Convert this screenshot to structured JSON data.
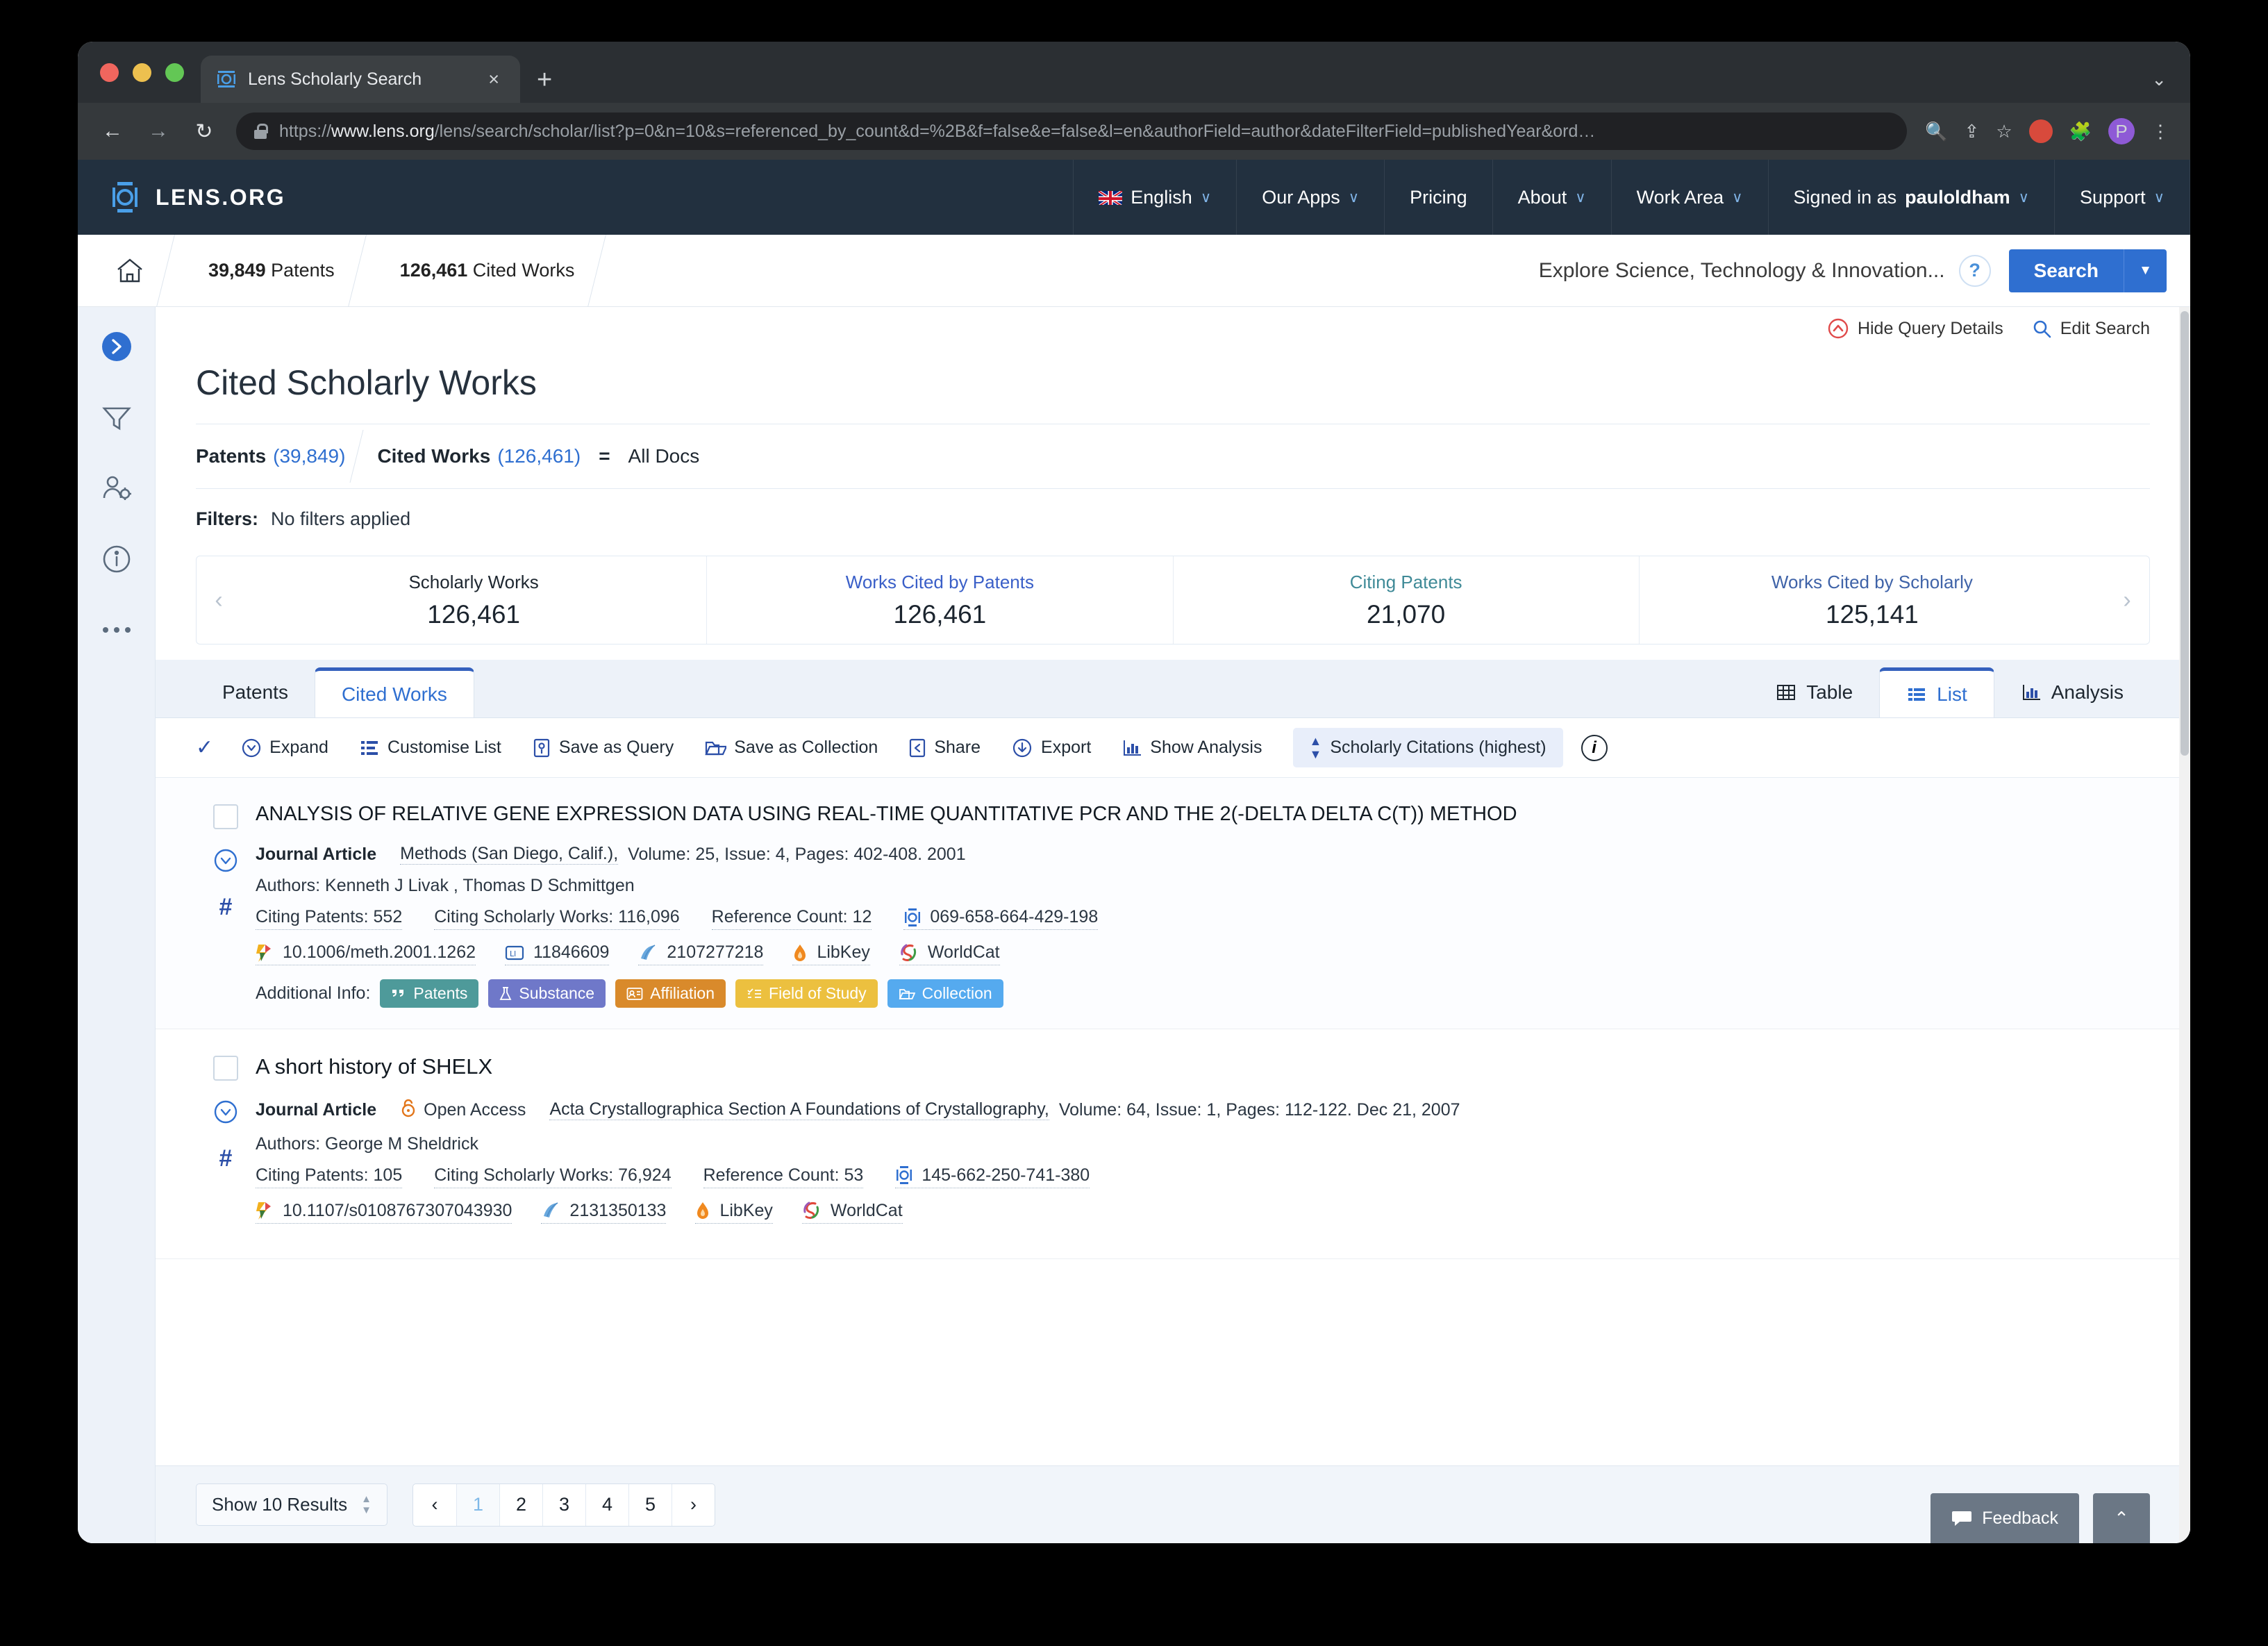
{
  "browser": {
    "tab": {
      "title": "Lens Scholarly Search",
      "favicon": "lens-logo-icon",
      "close": "×"
    },
    "newtab_label": "+",
    "nav": {
      "back": "←",
      "forward": "→",
      "reload": "↻"
    },
    "url": {
      "scheme": "https://",
      "host": "www.lens.org",
      "path": "/lens/search/scholar/list?p=0&n=10&s=referenced_by_count&d=%2B&f=false&e=false&l=en&authorField=author&dateFilterField=publishedYear&ord…"
    },
    "omni": {
      "zoom_icon": "search-zoom-icon",
      "share_icon": "share-icon",
      "star_icon": "bookmark-star-icon",
      "puzzle_icon": "extensions-puzzle-icon",
      "profile_initial": "P",
      "menu_icon": "⋮"
    }
  },
  "topnav": {
    "brand": "LENS.ORG",
    "items": [
      {
        "label": "English",
        "caret": "∨",
        "has_flag": true
      },
      {
        "label": "Our Apps",
        "caret": "∨"
      },
      {
        "label": "Pricing",
        "caret": ""
      },
      {
        "label": "About",
        "caret": "∨"
      },
      {
        "label": "Work Area",
        "caret": "∨"
      },
      {
        "label": "Signed in as ",
        "bold": "pauloldham",
        "caret": "∨"
      },
      {
        "label": "Support",
        "caret": "∨"
      }
    ]
  },
  "breadcrumb": {
    "home_icon": "home-icon",
    "items": [
      {
        "count": "39,849",
        "label": "Patents",
        "bold": false
      },
      {
        "count": "126,461",
        "label": "Cited Works",
        "bold": true
      }
    ],
    "explore_text": "Explore Science, Technology & Innovation...",
    "help": "?",
    "search_label": "Search",
    "search_caret": "▼"
  },
  "query": {
    "hide_details_label": "Hide Query Details",
    "edit_search_label": "Edit Search",
    "page_title": "Cited Scholarly Works",
    "seg1_label": "Patents",
    "seg1_count": "(39,849)",
    "seg2_label": "Cited Works",
    "seg2_count": "(126,461)",
    "equals": "=",
    "all_docs": "All Docs",
    "filters_label": "Filters:",
    "filters_value": "No filters applied"
  },
  "stats": {
    "prev": "‹",
    "next": "›",
    "cards": [
      {
        "label": "Scholarly Works",
        "value": "126,461",
        "style": "plain"
      },
      {
        "label": "Works Cited by Patents",
        "value": "126,461",
        "style": "link"
      },
      {
        "label": "Citing Patents",
        "value": "21,070",
        "style": "teal"
      },
      {
        "label": "Works Cited by Scholarly",
        "value": "125,141",
        "style": "slate"
      }
    ]
  },
  "viewtabs": {
    "left": [
      {
        "label": "Patents",
        "selected": false
      },
      {
        "label": "Cited Works",
        "selected": true
      }
    ],
    "right": [
      {
        "label": "Table",
        "icon": "table-grid-icon",
        "selected": false
      },
      {
        "label": "List",
        "icon": "list-icon",
        "selected": true
      },
      {
        "label": "Analysis",
        "icon": "bar-chart-icon",
        "selected": false
      }
    ]
  },
  "toolbar": {
    "select_all_icon": "checkmark-icon",
    "items": [
      {
        "label": "Expand",
        "icon": "chevron-down-circle-icon"
      },
      {
        "label": "Customise List",
        "icon": "customise-list-icon"
      },
      {
        "label": "Save as Query",
        "icon": "save-query-icon"
      },
      {
        "label": "Save as Collection",
        "icon": "folder-icon"
      },
      {
        "label": "Share",
        "icon": "share-icon"
      },
      {
        "label": "Export",
        "icon": "export-download-icon"
      },
      {
        "label": "Show Analysis",
        "icon": "bar-chart-icon"
      }
    ],
    "sort_label": "Scholarly Citations (highest)",
    "sort_icon": "sort-updown-icon",
    "info_icon": "info-circle-icon"
  },
  "results": [
    {
      "title": "ANALYSIS OF RELATIVE GENE EXPRESSION DATA USING REAL-TIME QUANTITATIVE PCR AND THE 2(-DELTA DELTA C(T)) METHOD",
      "type": "Journal Article",
      "open_access": null,
      "journal": "Methods (San Diego, Calif.),",
      "citation_rest": "Volume: 25,  Issue: 4,  Pages: 402-408.  2001",
      "authors": "Authors: Kenneth J Livak , Thomas D Schmittgen",
      "counts": [
        {
          "label": "Citing Patents: 552"
        },
        {
          "label": "Citing Scholarly Works: 116,096"
        },
        {
          "label": "Reference Count: 12"
        }
      ],
      "lens_id": "069-658-664-429-198",
      "ids": [
        {
          "label": "10.1006/meth.2001.1262",
          "icon": "doi-icon"
        },
        {
          "label": "11846609",
          "icon": "pubmed-icon"
        },
        {
          "label": "2107277218",
          "icon": "microsoft-academic-icon"
        },
        {
          "label": "LibKey",
          "icon": "libkey-icon"
        },
        {
          "label": "WorldCat",
          "icon": "worldcat-icon"
        }
      ],
      "additional_info_label": "Additional Info:",
      "badges": [
        {
          "label": "Patents",
          "color": "#4e9a9a",
          "icon": "patents-icon"
        },
        {
          "label": "Substance",
          "color": "#6f78c9",
          "icon": "flask-icon"
        },
        {
          "label": "Affiliation",
          "color": "#d98a2b",
          "icon": "id-card-icon"
        },
        {
          "label": "Field of Study",
          "color": "#ecc03f",
          "icon": "field-of-study-icon"
        },
        {
          "label": "Collection",
          "color": "#55aaef",
          "icon": "folder-icon"
        }
      ]
    },
    {
      "title": "A short history of SHELX",
      "type": "Journal Article",
      "open_access": "Open Access",
      "journal": "Acta Crystallographica Section A Foundations of Crystallography,",
      "citation_rest": "Volume: 64,  Issue: 1,  Pages: 112-122.  Dec 21, 2007",
      "authors": "Authors: George M Sheldrick",
      "counts": [
        {
          "label": "Citing Patents: 105"
        },
        {
          "label": "Citing Scholarly Works: 76,924"
        },
        {
          "label": "Reference Count: 53"
        }
      ],
      "lens_id": "145-662-250-741-380",
      "ids": [
        {
          "label": "10.1107/s0108767307043930",
          "icon": "doi-icon"
        },
        {
          "label": "2131350133",
          "icon": "microsoft-academic-icon"
        },
        {
          "label": "LibKey",
          "icon": "libkey-icon"
        },
        {
          "label": "WorldCat",
          "icon": "worldcat-icon"
        }
      ],
      "additional_info_label": "",
      "badges": []
    }
  ],
  "footer": {
    "show_results_label": "Show 10 Results",
    "pages": [
      "1",
      "2",
      "3",
      "4",
      "5"
    ],
    "current_page": "1",
    "prev": "‹",
    "next": "›",
    "feedback_label": "Feedback",
    "scroll_top": "⌃"
  }
}
